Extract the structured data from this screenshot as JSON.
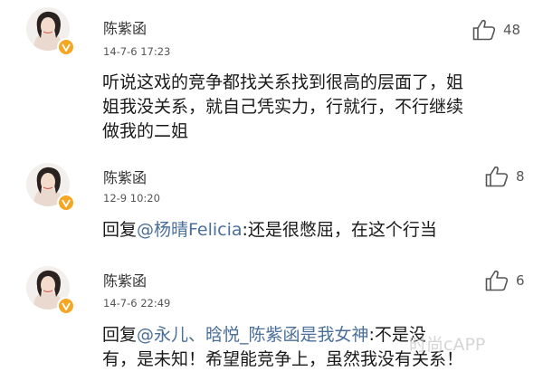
{
  "comments": [
    {
      "user": "陈紫函",
      "time": "14-7-6 17:23",
      "likes": "48",
      "line1": "听说这戏的竞争都找关系找到很高的层面了，姐",
      "line2": "姐我没关系，就自己凭实力，行就行，不行继续",
      "line3": "做我的二姐"
    },
    {
      "user": "陈紫函",
      "time": "12-9 10:20",
      "likes": "8",
      "reply_prefix": "回复",
      "mention": "@杨晴Felicia",
      "text": ":还是很憋屈，在这个行当"
    },
    {
      "user": "陈紫函",
      "time": "14-7-6 22:49",
      "likes": "6",
      "reply_prefix": "回复",
      "mention": "@永儿、晗悦_陈紫函是我女神",
      "text_line1": ":不是没",
      "line2": "有，是未知！希望能竞争上，虽然我没有关系！"
    }
  ],
  "watermark": "时尚cAPP",
  "colors": {
    "mention": "#4a6f9a",
    "badge": "#f5a623",
    "text": "#1a1a1a"
  },
  "icons": {
    "like": "thumbs-up-icon",
    "verified": "verified-badge-icon"
  }
}
